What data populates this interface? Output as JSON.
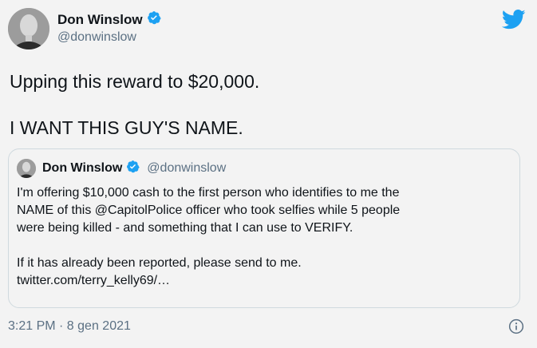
{
  "author": {
    "name": "Don Winslow",
    "handle": "@donwinslow",
    "verified_icon": "verified-badge-icon",
    "avatar_icon": "avatar-icon"
  },
  "brand": {
    "icon": "twitter-bird-icon",
    "color": "#1da1f2"
  },
  "tweet": {
    "line1": "Upping this reward to $20,000.",
    "line2": "I WANT THIS GUY'S NAME."
  },
  "quoted_tweet": {
    "name": "Don Winslow",
    "handle": "@donwinslow",
    "line1": "I'm offering $10,000 cash to the first person who identifies to me the",
    "line2": "NAME of this @CapitolPolice officer who took selfies while 5 people",
    "line3": "were being killed - and something that I can use to VERIFY.",
    "line4": "If it has already been reported, please send to me.",
    "line5": "twitter.com/terry_kelly69/…"
  },
  "meta": {
    "timestamp": "3:21 PM · 8 gen 2021",
    "info_icon": "info-icon"
  },
  "colors": {
    "text": "#0f1419",
    "secondary": "#5b7083",
    "border": "#cfd9de",
    "background": "#f3f3f3",
    "verified": "#1da1f2"
  }
}
